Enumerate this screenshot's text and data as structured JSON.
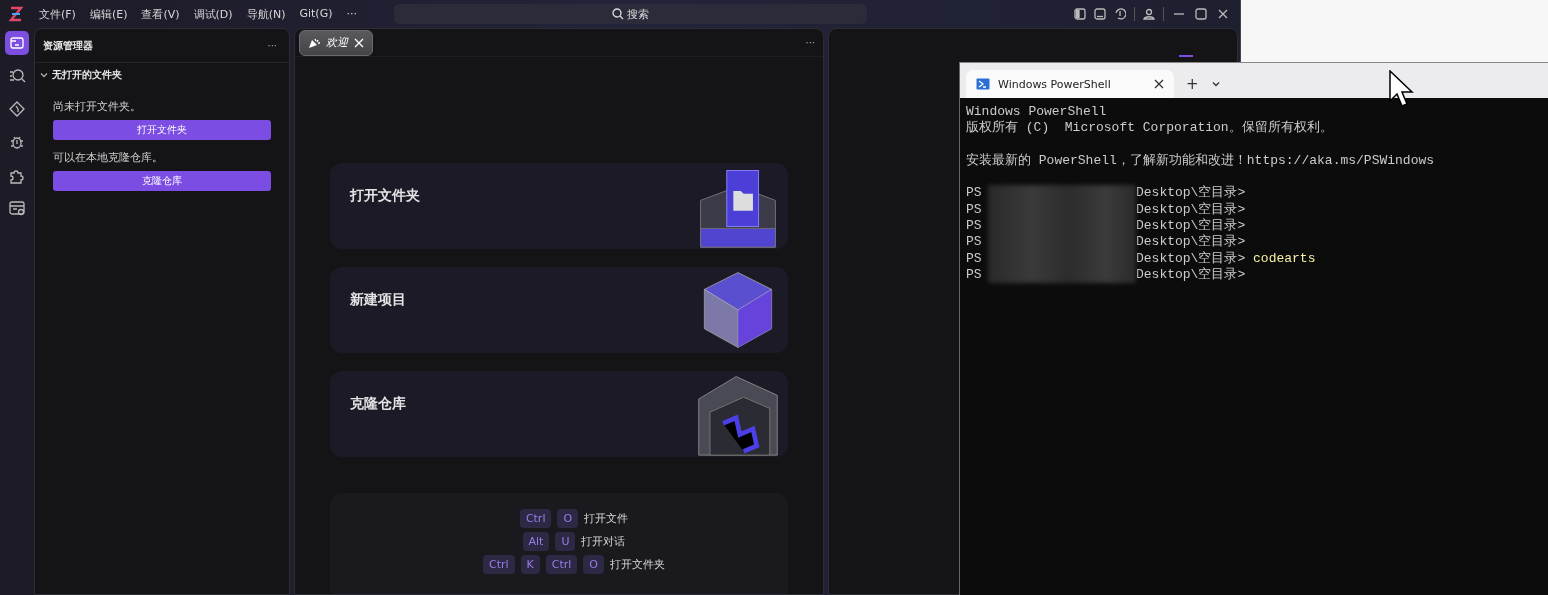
{
  "ide": {
    "menu": [
      "文件(F)",
      "编辑(E)",
      "查看(V)",
      "调试(D)",
      "导航(N)",
      "Git(G)",
      "···"
    ],
    "search": {
      "label": "搜索"
    },
    "activity_bar": [
      {
        "kind": "explorer",
        "selected": true
      },
      {
        "kind": "search",
        "selected": false
      },
      {
        "kind": "git",
        "selected": false
      },
      {
        "kind": "debug",
        "selected": false
      },
      {
        "kind": "extensions",
        "selected": false
      },
      {
        "kind": "remote",
        "selected": false
      }
    ],
    "explorer": {
      "title": "资源管理器",
      "more": "···",
      "section": {
        "title": "无打开的文件夹",
        "expanded": true
      },
      "messages": [
        {
          "text": "尚未打开文件夹。",
          "button": "打开文件夹"
        },
        {
          "text": "可以在本地克隆仓库。",
          "button": "克隆仓库"
        }
      ]
    },
    "editor": {
      "tabs": [
        {
          "label": "欢迎",
          "selected": true
        }
      ],
      "more": "···",
      "cards": [
        {
          "title": "打开文件夹",
          "kind": "folder"
        },
        {
          "title": "新建项目",
          "kind": "cube"
        },
        {
          "title": "克隆仓库",
          "kind": "repo"
        }
      ],
      "shortcuts": [
        {
          "keys": [
            "Ctrl",
            "O"
          ],
          "label": "打开文件"
        },
        {
          "keys": [
            "Alt",
            "U"
          ],
          "label": "打开对话"
        },
        {
          "keys": [
            "Ctrl",
            "K",
            "Ctrl",
            "O"
          ],
          "label": "打开文件夹"
        }
      ]
    }
  },
  "terminal": {
    "tabs": [
      {
        "title": "Windows PowerShell",
        "selected": true
      }
    ],
    "new_tab": "+",
    "redacted": true,
    "lines": [
      {
        "kind": "text",
        "text": "Windows PowerShell"
      },
      {
        "kind": "text",
        "text": "版权所有 (C)  Microsoft Corporation。保留所有权利。"
      },
      {
        "kind": "blank"
      },
      {
        "kind": "text",
        "text": "安装最新的 PowerShell，了解新功能和改进！https://aka.ms/PSWindows"
      },
      {
        "kind": "blank"
      }
    ],
    "prompts": [
      {
        "prefix": "PS",
        "path": "Desktop\\空目录>"
      },
      {
        "prefix": "PS",
        "path": "Desktop\\空目录>"
      },
      {
        "prefix": "PS",
        "path": "Desktop\\空目录>"
      },
      {
        "prefix": "PS",
        "path": "Desktop\\空目录>"
      },
      {
        "prefix": "PS",
        "path": "Desktop\\空目录>",
        "command": "codearts"
      },
      {
        "prefix": "PS",
        "path": "Desktop\\空目录>"
      }
    ]
  }
}
